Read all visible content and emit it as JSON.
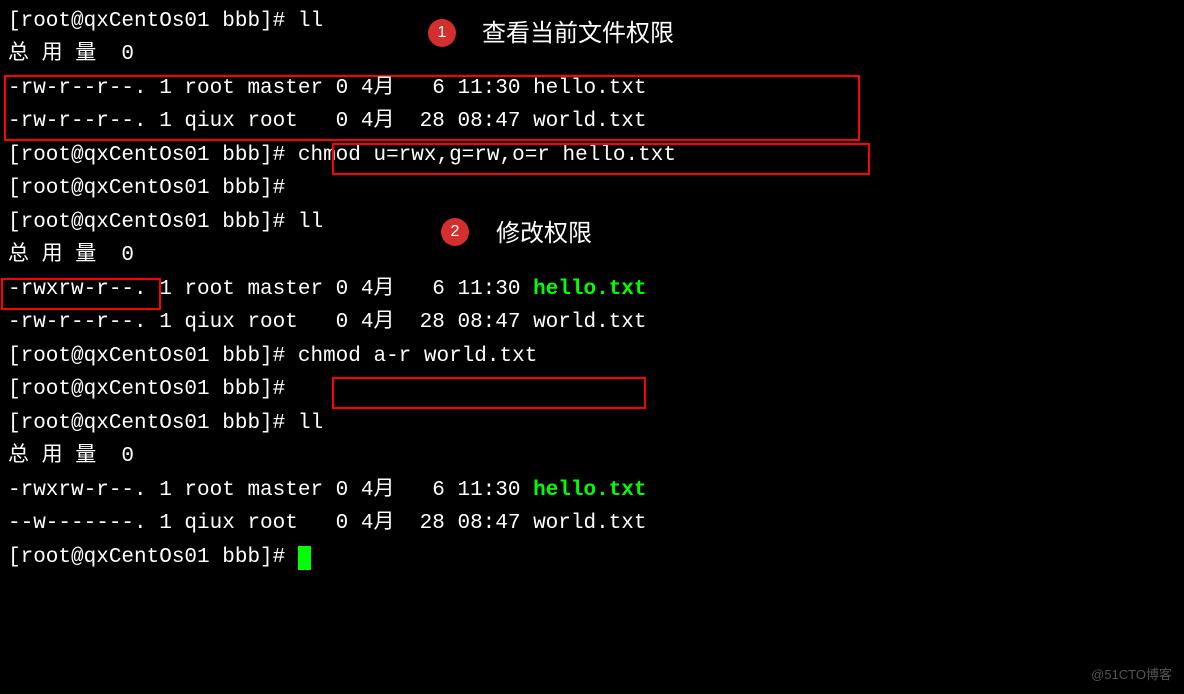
{
  "prompt": "[root@qxCentOs01 bbb]#",
  "commands": {
    "ll": "ll",
    "chmod1": "chmod u=rwx,g=rw,o=r hello.txt",
    "chmod2": "chmod a-r world.txt"
  },
  "total_line": "总 用 量  0",
  "listing1": {
    "row1": "-rw-r--r--. 1 root master 0 4月   6 11:30 hello.txt",
    "row2": "-rw-r--r--. 1 qiux root   0 4月  28 08:47 world.txt"
  },
  "listing2": {
    "row1_perm": "-rwxrw-r--.",
    "row1_rest": " 1 root master 0 4月   6 11:30 ",
    "row1_file": "hello.txt",
    "row2": "-rw-r--r--. 1 qiux root   0 4月  28 08:47 world.txt"
  },
  "listing3": {
    "row1": "-rwxrw-r--. 1 root master 0 4月   6 11:30 ",
    "row1_file": "hello.txt",
    "row2": "--w-------. 1 qiux root   0 4月  28 08:47 world.txt"
  },
  "annotations": {
    "badge1": "1",
    "label1": "查看当前文件权限",
    "badge2": "2",
    "label2": "修改权限"
  },
  "watermark": "@51CTO博客"
}
